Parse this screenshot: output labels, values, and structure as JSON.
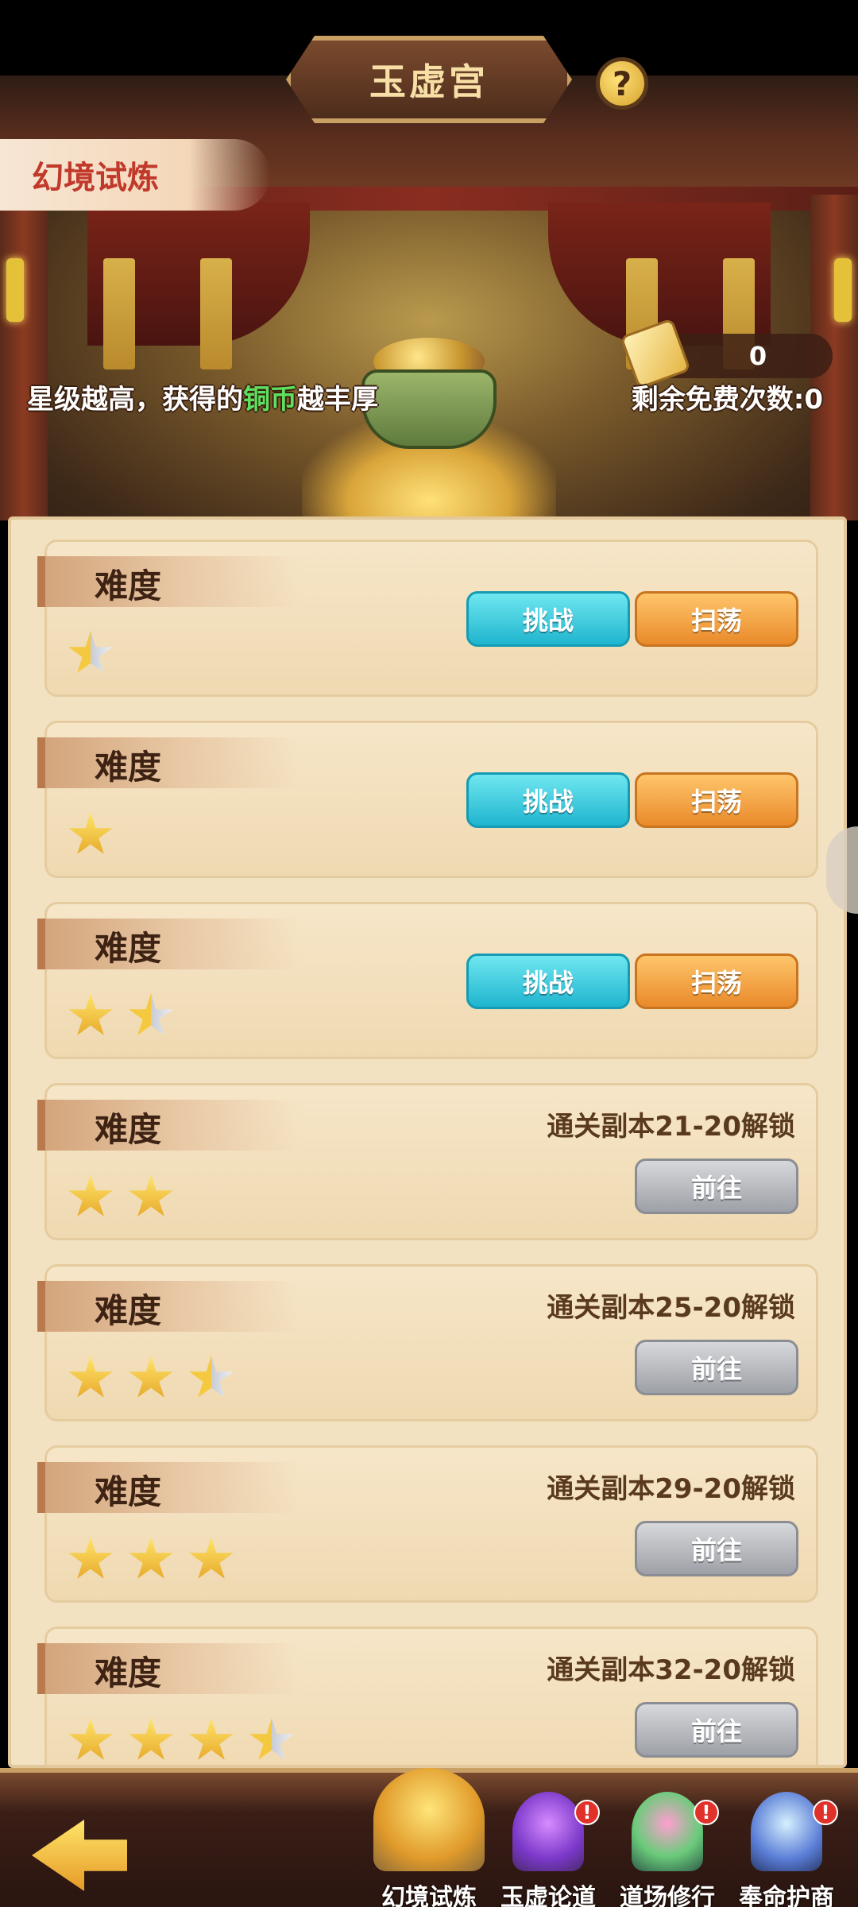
{
  "header": {
    "title": "玉虚宫",
    "help_label": "?",
    "mode_label": "幻境试炼",
    "hint_prefix": "星级越高，获得的",
    "hint_accent": "铜币",
    "hint_suffix": "越丰厚",
    "ticket_count": "0",
    "free_count_text": "剩余免费次数:0"
  },
  "difficulty_label": "难度",
  "buttons": {
    "challenge": "挑战",
    "sweep": "扫荡",
    "goto": "前往"
  },
  "rows": [
    {
      "stars": 0.5,
      "unlocked": true
    },
    {
      "stars": 1,
      "unlocked": true
    },
    {
      "stars": 1.5,
      "unlocked": true
    },
    {
      "stars": 2,
      "unlocked": false,
      "unlock_text": "通关副本21-20解锁"
    },
    {
      "stars": 2.5,
      "unlocked": false,
      "unlock_text": "通关副本25-20解锁"
    },
    {
      "stars": 3,
      "unlocked": false,
      "unlock_text": "通关副本29-20解锁"
    },
    {
      "stars": 3.5,
      "unlocked": false,
      "unlock_text": "通关副本32-20解锁"
    }
  ],
  "nav": {
    "tabs": [
      {
        "label": "幻境试炼",
        "active": true,
        "badge": ""
      },
      {
        "label": "玉虚论道",
        "active": false,
        "badge": "!"
      },
      {
        "label": "道场修行",
        "active": false,
        "badge": "!"
      },
      {
        "label": "奉命护商",
        "active": false,
        "badge": "!"
      }
    ]
  }
}
